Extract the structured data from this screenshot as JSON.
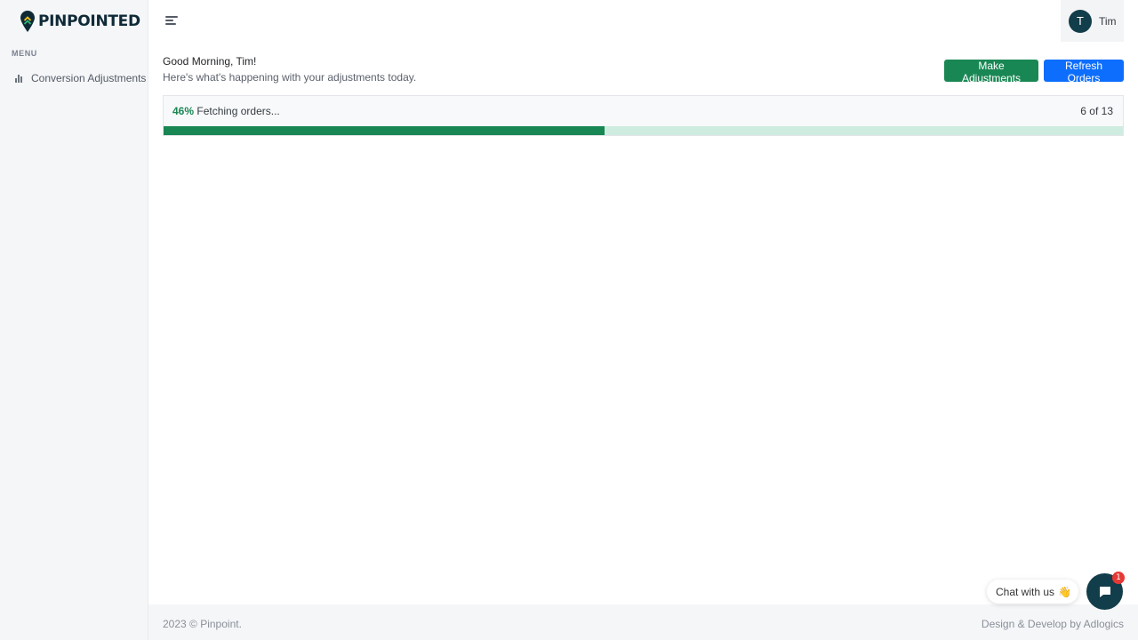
{
  "brand": {
    "name": "PINPOINTED"
  },
  "sidebar": {
    "menu_title": "MENU",
    "items": [
      {
        "label": "Conversion Adjustments",
        "icon": "bar-chart-icon"
      }
    ]
  },
  "header": {
    "user": {
      "initial": "T",
      "name": "Tim"
    }
  },
  "main": {
    "greeting": "Good Morning, Tim!",
    "subtitle": "Here's what's happening with your adjustments today.",
    "buttons": {
      "make_adjustments": "Make Adjustments",
      "refresh_orders": "Refresh Orders"
    },
    "progress": {
      "percent_label": "46%",
      "status": "Fetching orders...",
      "count": "6 of 13",
      "fraction": 0.46
    }
  },
  "footer": {
    "left": "2023 © Pinpoint.",
    "right": "Design & Develop by Adlogics"
  },
  "chat": {
    "label": "Chat with us",
    "emoji": "👋",
    "badge": "1"
  },
  "colors": {
    "primary_green": "#198754",
    "primary_blue": "#0d6efd",
    "brand_dark": "#123d4a",
    "progress_track": "#cfece0"
  }
}
